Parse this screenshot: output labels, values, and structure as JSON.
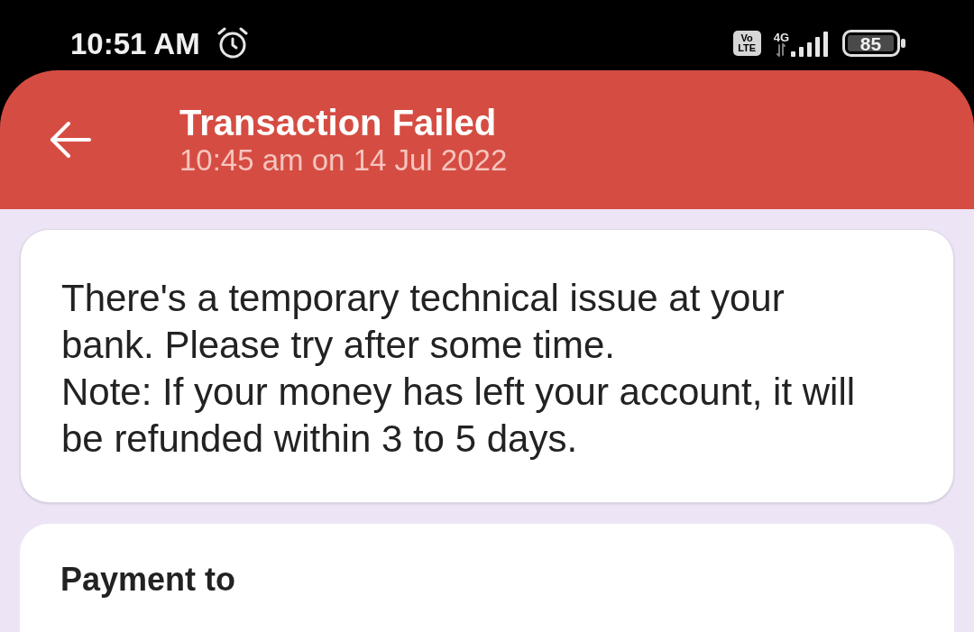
{
  "status_bar": {
    "time": "10:51 AM",
    "network_badge": [
      "Vo",
      "LTE"
    ],
    "network_type": "4G",
    "battery": "85"
  },
  "header": {
    "title": "Transaction Failed",
    "subtitle": "10:45 am on 14 Jul 2022"
  },
  "error_card": {
    "message": "There's a temporary technical issue at your bank. Please try after some time.",
    "note": "Note: If your money has left your account, it will be refunded within 3 to 5 days."
  },
  "payment_card": {
    "heading": "Payment to"
  }
}
